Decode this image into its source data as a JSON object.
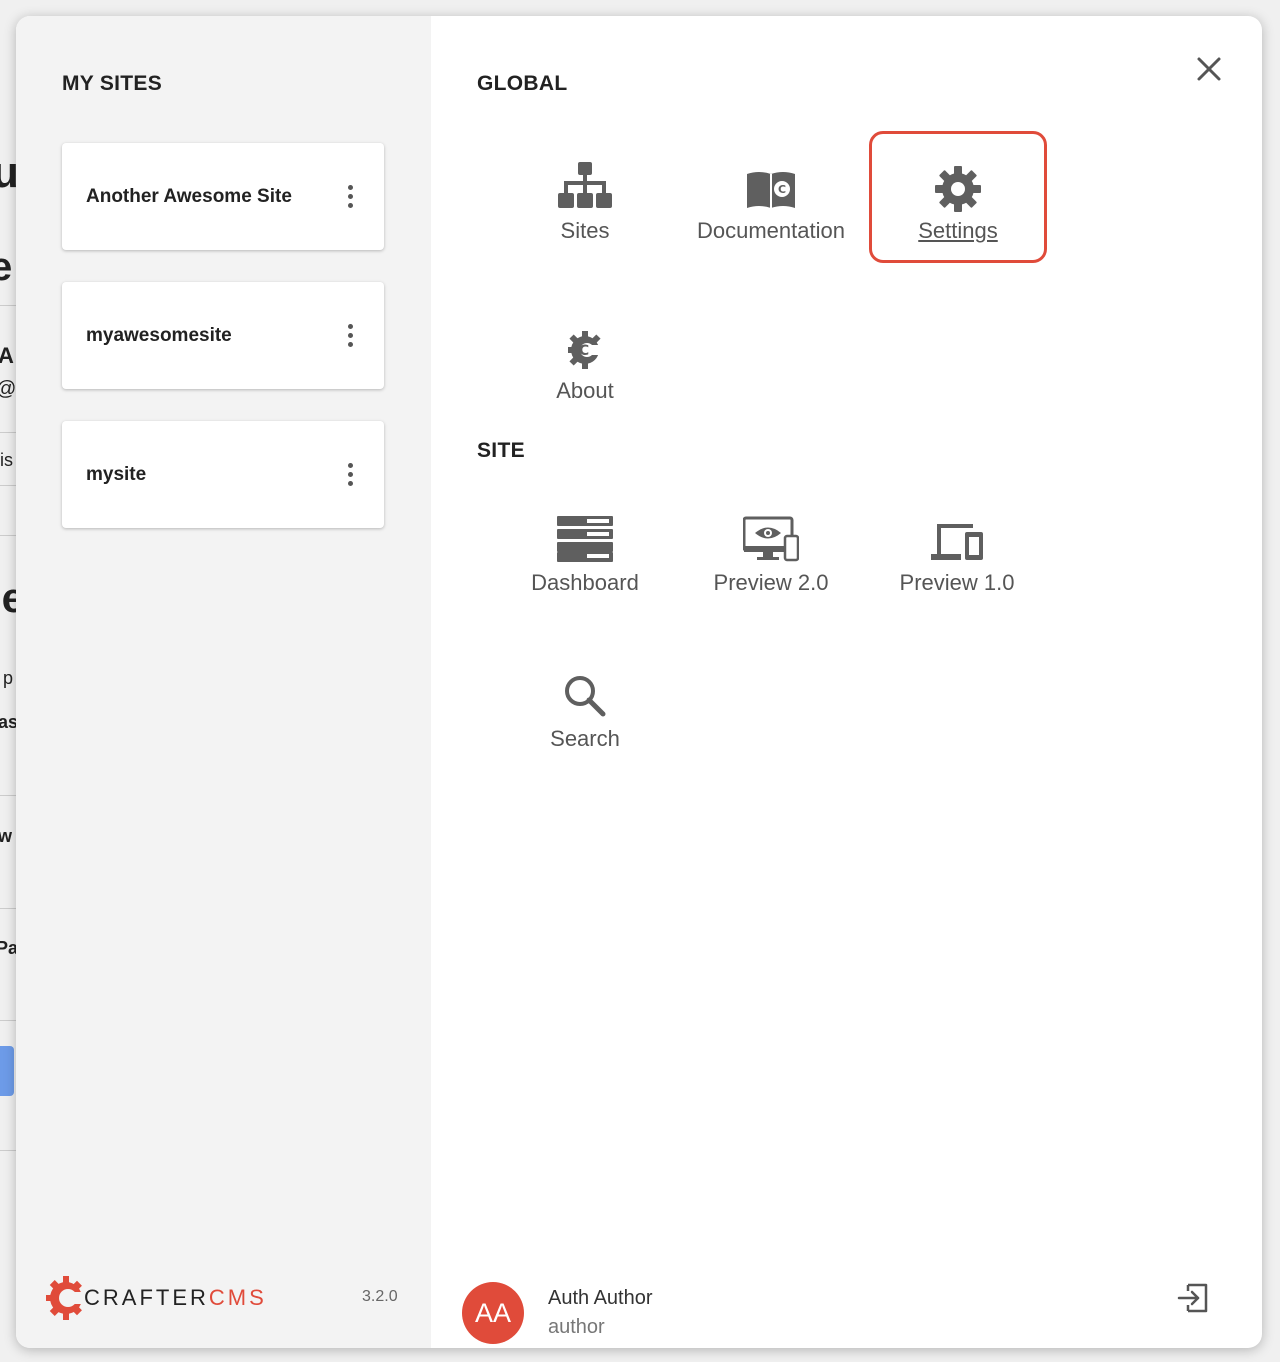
{
  "background": {
    "fragments": [
      "u",
      "e",
      "A",
      "@",
      "lis",
      "ge",
      "r p",
      "as",
      "w",
      "Pa"
    ]
  },
  "sidebar": {
    "title": "MY SITES",
    "sites": [
      {
        "name": "Another Awesome Site"
      },
      {
        "name": "myawesomesite"
      },
      {
        "name": "mysite"
      }
    ],
    "logo": {
      "brand_main": "CRAFTER",
      "brand_accent": "CMS"
    },
    "version": "3.2.0"
  },
  "global": {
    "title": "GLOBAL",
    "items": [
      {
        "label": "Sites",
        "icon": "sites-icon"
      },
      {
        "label": "Documentation",
        "icon": "documentation-icon"
      },
      {
        "label": "Settings",
        "icon": "gear-icon",
        "selected": true
      },
      {
        "label": "About",
        "icon": "crafter-logo-icon"
      }
    ]
  },
  "site": {
    "title": "SITE",
    "items": [
      {
        "label": "Dashboard",
        "icon": "dashboard-icon"
      },
      {
        "label": "Preview 2.0",
        "icon": "preview-icon"
      },
      {
        "label": "Preview 1.0",
        "icon": "devices-icon"
      },
      {
        "label": "Search",
        "icon": "search-icon"
      }
    ]
  },
  "user": {
    "initials": "AA",
    "name": "Auth Author",
    "role": "author"
  },
  "colors": {
    "accent": "#e04b3a",
    "icon": "#5f5f5f",
    "sidebar_bg": "#f3f3f3"
  }
}
